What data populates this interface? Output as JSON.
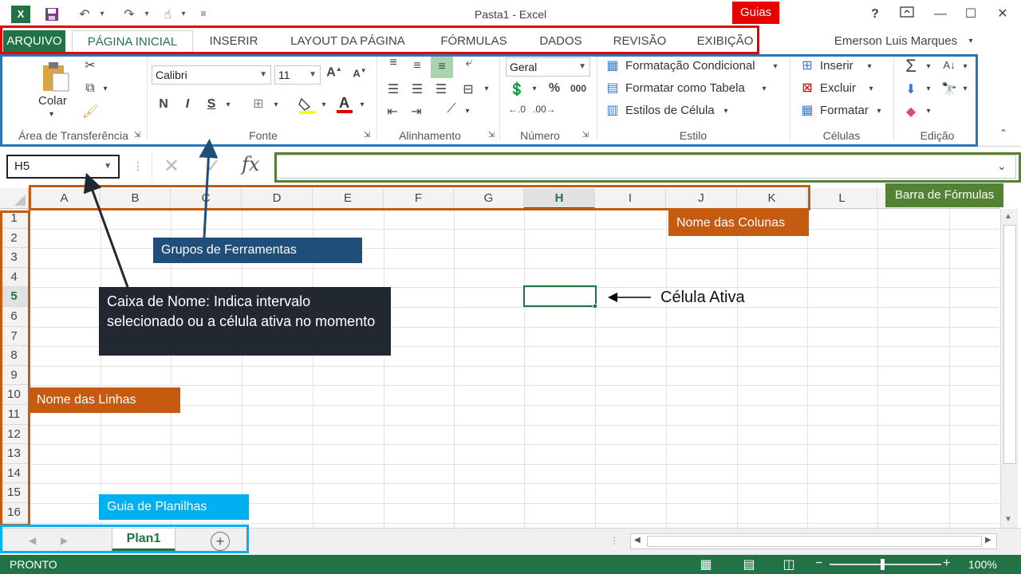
{
  "window": {
    "title": "Pasta1 - Excel",
    "help": "?",
    "user": "Emerson Luis Marques"
  },
  "tabs": [
    {
      "label": "ARQUIVO"
    },
    {
      "label": "PÁGINA INICIAL"
    },
    {
      "label": "INSERIR"
    },
    {
      "label": "LAYOUT DA PÁGINA"
    },
    {
      "label": "FÓRMULAS"
    },
    {
      "label": "DADOS"
    },
    {
      "label": "REVISÃO"
    },
    {
      "label": "EXIBIÇÃO"
    }
  ],
  "ribbon": {
    "clipboard": {
      "paste_label": "Colar",
      "group": "Área de Transferência"
    },
    "font": {
      "font_name": "Calibri",
      "font_size": "11",
      "bold": "N",
      "italic": "I",
      "underline": "S",
      "group": "Fonte"
    },
    "alignment": {
      "group": "Alinhamento"
    },
    "number": {
      "format": "Geral",
      "group": "Número"
    },
    "styles": {
      "conditional": "Formatação Condicional",
      "as_table": "Formatar como Tabela",
      "cell_styles": "Estilos de Célula",
      "group": "Estilo"
    },
    "cells": {
      "insert": "Inserir",
      "delete": "Excluir",
      "format": "Formatar",
      "group": "Células"
    },
    "editing": {
      "group": "Edição"
    }
  },
  "formula_bar": {
    "name_box": "H5",
    "fx": "fx"
  },
  "grid": {
    "columns": [
      "A",
      "B",
      "C",
      "D",
      "E",
      "F",
      "G",
      "H",
      "I",
      "J",
      "K",
      "L"
    ],
    "rows": [
      "1",
      "2",
      "3",
      "4",
      "5",
      "6",
      "7",
      "8",
      "9",
      "10",
      "11",
      "12",
      "13",
      "14",
      "15",
      "16"
    ],
    "active_column": "H",
    "active_row": "5"
  },
  "sheets": {
    "tabs": [
      {
        "label": "Plan1"
      }
    ],
    "add": "+"
  },
  "status": {
    "mode": "PRONTO",
    "zoom": "100%"
  },
  "annotations": {
    "guias": "Guias",
    "barra_formulas": "Barra de Fórmulas",
    "nome_colunas": "Nome das Colunas",
    "grupos_ferramentas": "Grupos de Ferramentas",
    "caixa_nome": "Caixa de Nome: Indica intervalo selecionado ou a célula ativa no momento",
    "celula_ativa": "Célula Ativa",
    "nome_linhas": "Nome das Linhas",
    "guia_planilhas": "Guia de Planilhas"
  },
  "colors": {
    "excel_green": "#217346",
    "ann_red": "#e60000",
    "ann_blue": "#2e75b6",
    "ann_dark": "#222831",
    "ann_orange": "#c55a11",
    "ann_green": "#548235",
    "ann_cyan": "#00b0f0",
    "ann_navy": "#1f4e79"
  }
}
